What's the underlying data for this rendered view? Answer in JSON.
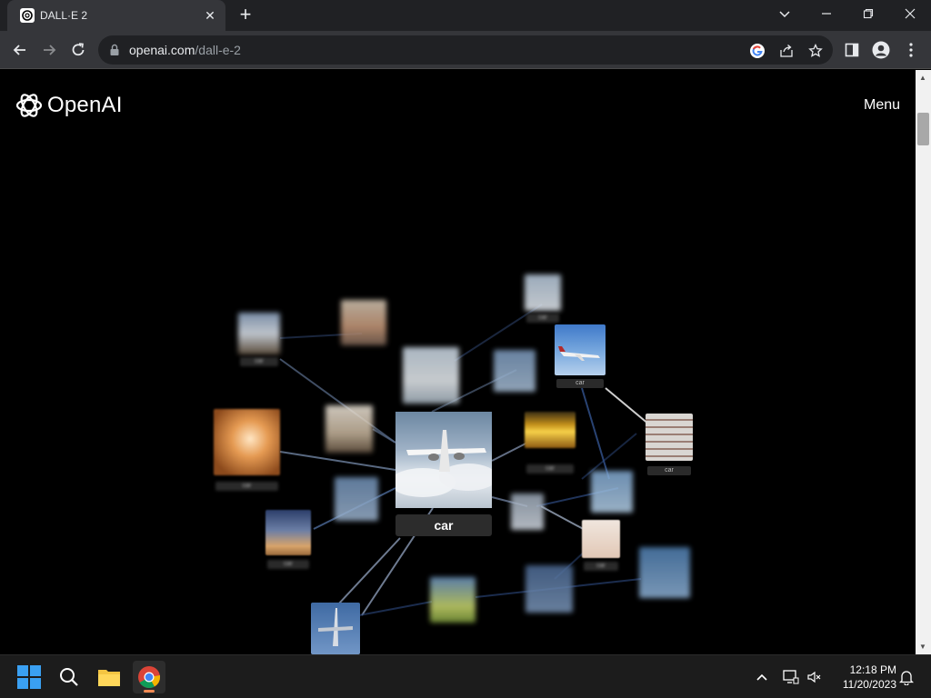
{
  "browser": {
    "tab_title": "DALL·E 2",
    "url_host": "openai.com",
    "url_path": "/dall-e-2",
    "tab_close": "✕",
    "new_tab": "+"
  },
  "page": {
    "brand": "OpenAI",
    "menu_label": "Menu",
    "center_label": "car",
    "mini_label": "car"
  },
  "taskbar": {
    "time": "12:18 PM",
    "date": "11/20/2023"
  },
  "colors": {
    "chrome_dark": "#202124",
    "chrome_toolbar": "#35363a",
    "page_bg": "#000000",
    "taskbar_bg": "#1c1c1c",
    "chrome_indicator": "#f28b54"
  }
}
